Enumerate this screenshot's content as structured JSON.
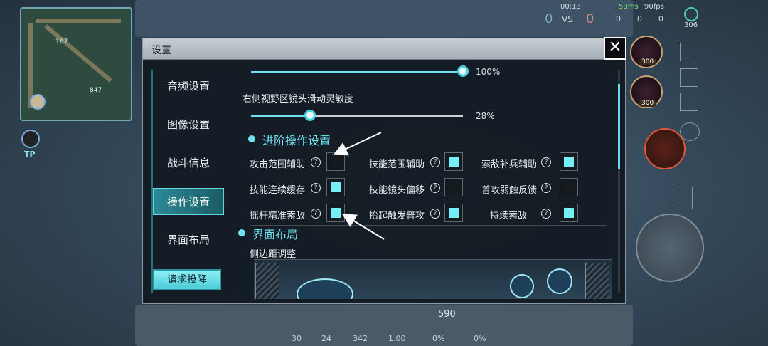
{
  "hud": {
    "time": "00:13",
    "ping": "53ms",
    "fps": "90fps",
    "score_left": "0",
    "vs": "VS",
    "score_right": "0",
    "kills": "0",
    "deaths": "0",
    "assists": "0",
    "coins": "306",
    "tp_label": "TP",
    "minimap_num_a": "167",
    "minimap_num_b": "847",
    "skill_count_1": "300",
    "skill_count_2": "300",
    "level_badge": "590",
    "bottom_stats": [
      "30",
      "24",
      "342",
      "1.00",
      "0%",
      "0%"
    ]
  },
  "modal": {
    "title": "设置",
    "close_label": "✕"
  },
  "sidebar": {
    "items": [
      {
        "label": "音频设置",
        "active": false
      },
      {
        "label": "图像设置",
        "active": false
      },
      {
        "label": "战斗信息",
        "active": false
      },
      {
        "label": "操作设置",
        "active": true
      },
      {
        "label": "界面布局",
        "active": false
      }
    ],
    "surrender_label": "请求投降"
  },
  "content": {
    "top_slider_percent": "100%",
    "top_slider_value": 1.0,
    "camera_label": "右侧视野区镜头滑动灵敏度",
    "camera_percent": "28%",
    "camera_value": 0.28,
    "advanced_title": "进阶操作设置",
    "help_glyph": "?",
    "options": [
      {
        "label": "攻击范围辅助",
        "checked": false
      },
      {
        "label": "技能范围辅助",
        "checked": true
      },
      {
        "label": "索敌补兵辅助",
        "checked": true
      },
      {
        "label": "技能连续缓存",
        "checked": true
      },
      {
        "label": "技能镜头偏移",
        "checked": false
      },
      {
        "label": "普攻弱触反馈",
        "checked": false
      },
      {
        "label": "摇杆精准索敌",
        "checked": true
      },
      {
        "label": "抬起触发普攻",
        "checked": true
      },
      {
        "label": "持续索敌",
        "checked": true
      }
    ],
    "layout_title": "界面布局",
    "side_margin_label": "侧边距调整"
  },
  "colors": {
    "accent": "#6ee3ef",
    "panel_bg": "#141b23",
    "header_bg": "#b8c0c7"
  }
}
